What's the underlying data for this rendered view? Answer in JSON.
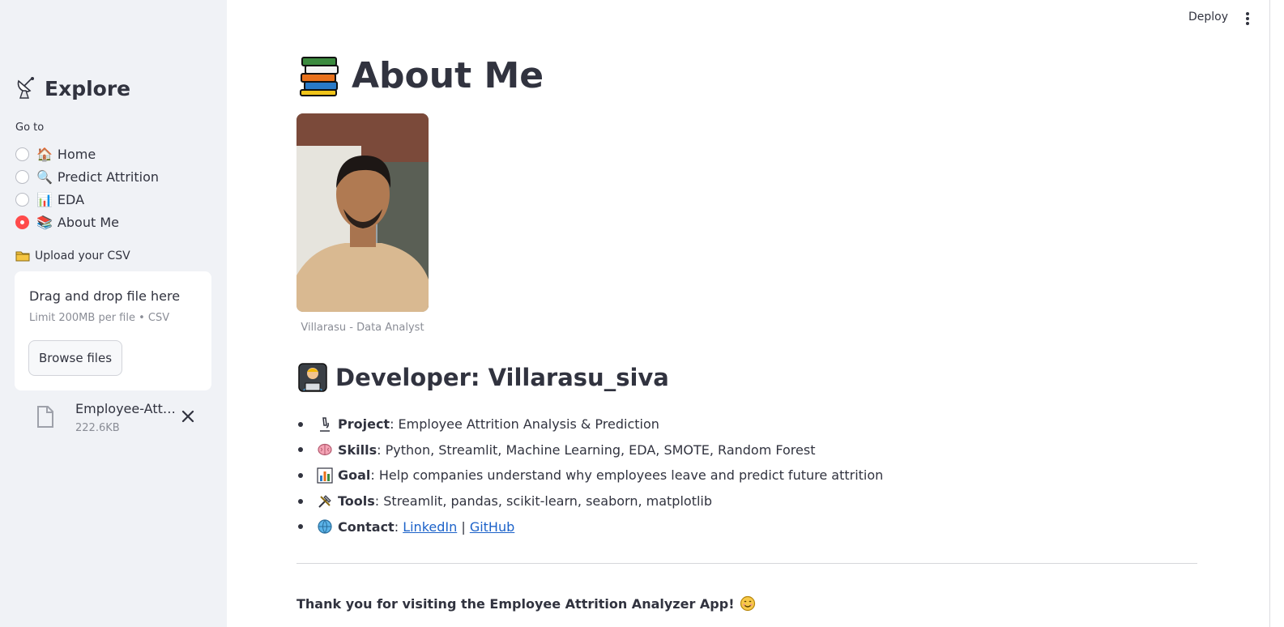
{
  "header": {
    "deploy_label": "Deploy"
  },
  "sidebar": {
    "title": "Explore",
    "goto_label": "Go to",
    "nav": [
      {
        "icon": "🏠",
        "label": "Home",
        "selected": false
      },
      {
        "icon": "🔍",
        "label": "Predict Attrition",
        "selected": false
      },
      {
        "icon": "📊",
        "label": "EDA",
        "selected": false
      },
      {
        "icon": "📚",
        "label": "About Me",
        "selected": true
      }
    ],
    "upload_label": "Upload your CSV",
    "dropzone": {
      "title": "Drag and drop file here",
      "subtitle": "Limit 200MB per file • CSV",
      "browse_label": "Browse files"
    },
    "file": {
      "name": "Employee-Attri...",
      "size": "222.6KB"
    }
  },
  "main": {
    "title": "About Me",
    "photo_caption": "Villarasu - Data Analyst",
    "developer_heading": "Developer: Villarasu_siva",
    "bullets": [
      {
        "key": "Project",
        "text": ": Employee Attrition Analysis & Prediction"
      },
      {
        "key": "Skills",
        "text": ": Python, Streamlit, Machine Learning, EDA, SMOTE, Random Forest"
      },
      {
        "key": "Goal",
        "text": ": Help companies understand why employees leave and predict future attrition"
      },
      {
        "key": "Tools",
        "text": ": Streamlit, pandas, scikit-learn, seaborn, matplotlib"
      },
      {
        "key": "Contact",
        "text": ": ",
        "link1": "LinkedIn",
        "sep": " | ",
        "link2": "GitHub"
      }
    ],
    "thanks": "Thank you for visiting the Employee Attrition Analyzer App!"
  },
  "colors": {
    "accent": "#ff4b4b",
    "link": "#1c62c9",
    "sidebar_bg": "#f0f2f6",
    "text": "#31333f"
  }
}
